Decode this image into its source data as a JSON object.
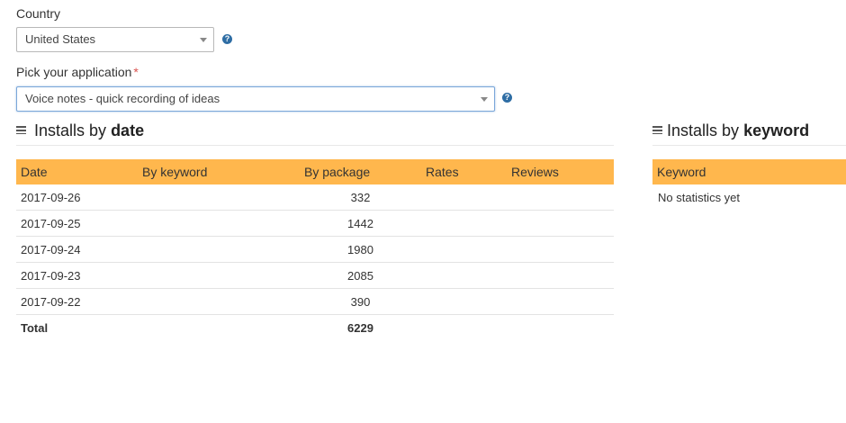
{
  "country": {
    "label": "Country",
    "selected": "United States"
  },
  "application": {
    "label": "Pick your application",
    "required_mark": "*",
    "selected": "Voice notes - quick recording of ideas"
  },
  "help_glyph": "?",
  "installs_by_date": {
    "title_prefix": "Installs by",
    "title_emphasis": "date",
    "columns": [
      "Date",
      "By keyword",
      "By package",
      "Rates",
      "Reviews"
    ],
    "rows": [
      {
        "date": "2017-09-26",
        "by_keyword": "",
        "by_package": "332",
        "rates": "",
        "reviews": ""
      },
      {
        "date": "2017-09-25",
        "by_keyword": "",
        "by_package": "1442",
        "rates": "",
        "reviews": ""
      },
      {
        "date": "2017-09-24",
        "by_keyword": "",
        "by_package": "1980",
        "rates": "",
        "reviews": ""
      },
      {
        "date": "2017-09-23",
        "by_keyword": "",
        "by_package": "2085",
        "rates": "",
        "reviews": ""
      },
      {
        "date": "2017-09-22",
        "by_keyword": "",
        "by_package": "390",
        "rates": "",
        "reviews": ""
      }
    ],
    "total": {
      "label": "Total",
      "by_package": "6229"
    }
  },
  "installs_by_keyword": {
    "title_prefix": "Installs by",
    "title_emphasis": "keyword",
    "column": "Keyword",
    "empty_message": "No statistics yet"
  },
  "colors": {
    "header_bg": "#ffb74d",
    "help_icon": "#2e6da4",
    "required": "#d9534f"
  }
}
